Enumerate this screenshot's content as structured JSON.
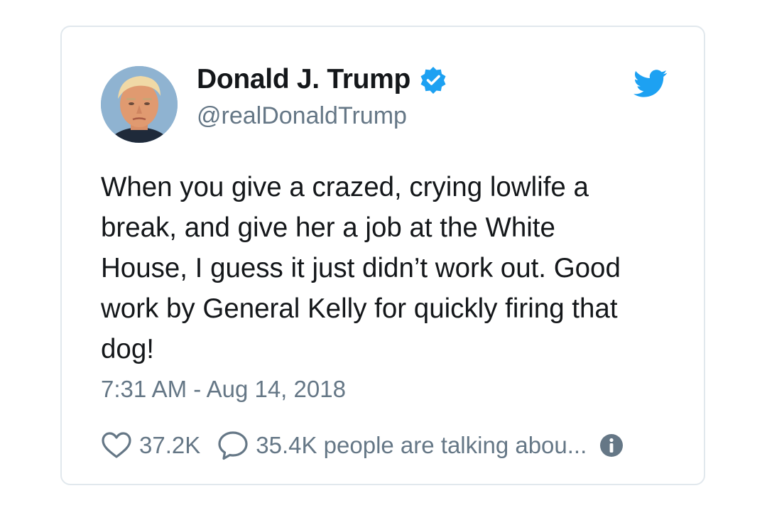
{
  "tweet": {
    "display_name": "Donald J. Trump",
    "handle": "@realDonaldTrump",
    "verified": true,
    "text": "When you give a crazed, crying lowlife a\nbreak, and give her a job at the White\nHouse, I guess it just didn’t work out. Good\nwork by General Kelly for quickly firing that\ndog!",
    "timestamp": "7:31 AM - Aug 14, 2018",
    "likes": "37.2K",
    "conversation": "35.4K people are talking abou..."
  },
  "icons": {
    "avatar": "avatar-photo",
    "verified": "verified-badge-icon",
    "brand": "twitter-bird-icon",
    "like": "heart-icon",
    "reply": "speech-bubble-icon",
    "info": "info-icon"
  },
  "colors": {
    "brand_blue": "#1da1f2",
    "text_primary": "#14171a",
    "text_secondary": "#657786",
    "border": "#e1e8ed"
  }
}
